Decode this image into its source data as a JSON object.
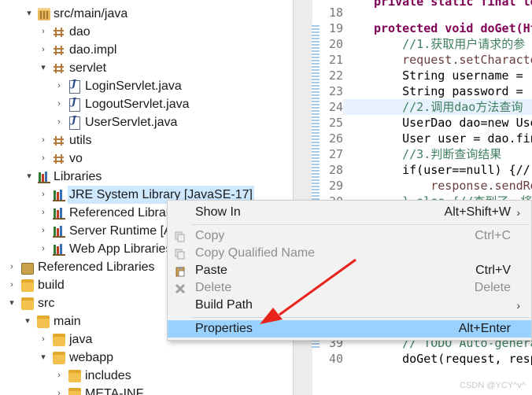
{
  "explorer": {
    "rows": [
      {
        "label": "src/main/java",
        "arrow": "▾",
        "icon": "source-folder-icon"
      },
      {
        "label": "dao",
        "arrow": "›",
        "icon": "package-icon"
      },
      {
        "label": "dao.impl",
        "arrow": "›",
        "icon": "package-icon"
      },
      {
        "label": "servlet",
        "arrow": "▾",
        "icon": "package-icon"
      },
      {
        "label": "LoginServlet.java",
        "arrow": "›",
        "icon": "java-file-icon"
      },
      {
        "label": "LogoutServlet.java",
        "arrow": "›",
        "icon": "java-file-icon"
      },
      {
        "label": "UserServlet.java",
        "arrow": "›",
        "icon": "java-file-icon"
      },
      {
        "label": "utils",
        "arrow": "›",
        "icon": "package-icon"
      },
      {
        "label": "vo",
        "arrow": "›",
        "icon": "package-icon"
      },
      {
        "label": "Libraries",
        "arrow": "▾",
        "icon": "library-icon"
      },
      {
        "label": "JRE System Library [JavaSE-17]",
        "arrow": "›",
        "icon": "library-icon"
      },
      {
        "label": "Referenced Libraries",
        "arrow": "›",
        "icon": "library-icon"
      },
      {
        "label": "Server Runtime [Apache Tomcat]",
        "arrow": "›",
        "icon": "library-icon"
      },
      {
        "label": "Web App Libraries",
        "arrow": "›",
        "icon": "library-icon"
      },
      {
        "label": "Referenced Libraries",
        "arrow": "›",
        "icon": "library-icon"
      },
      {
        "label": "build",
        "arrow": "›",
        "icon": "folder-icon"
      },
      {
        "label": "src",
        "arrow": "▾",
        "icon": "folder-icon"
      },
      {
        "label": "main",
        "arrow": "▾",
        "icon": "folder-icon"
      },
      {
        "label": "java",
        "arrow": "›",
        "icon": "folder-icon"
      },
      {
        "label": "webapp",
        "arrow": "▾",
        "icon": "folder-icon"
      },
      {
        "label": "includes",
        "arrow": "›",
        "icon": "folder-icon"
      },
      {
        "label": "META-INF",
        "arrow": "›",
        "icon": "folder-icon"
      }
    ]
  },
  "editor": {
    "lines": [
      {
        "num": "",
        "text": "private static final lo"
      },
      {
        "num": "18",
        "text": ""
      },
      {
        "num": "19",
        "text": "protected void doGet(Ht"
      },
      {
        "num": "20",
        "text": "    //1.获取用户请求的参"
      },
      {
        "num": "21",
        "text": "    request.setCharacte"
      },
      {
        "num": "22",
        "text": "    String username = r"
      },
      {
        "num": "23",
        "text": "    String password = r"
      },
      {
        "num": "24",
        "text": "    //2.调用dao方法查询"
      },
      {
        "num": "25",
        "text": "    UserDao dao=new Use"
      },
      {
        "num": "26",
        "text": "    User user = dao.fin"
      },
      {
        "num": "27",
        "text": "    //3.判断查询结果"
      },
      {
        "num": "28",
        "text": "    if(user==null) {//"
      },
      {
        "num": "29",
        "text": "        response.sendRe"
      },
      {
        "num": "30",
        "text": "    } else {//查到了，将"
      },
      {
        "num": "39",
        "text": "    // TODO Auto-genera"
      },
      {
        "num": "40",
        "text": "    doGet(request, resp"
      }
    ]
  },
  "context_menu": {
    "items": [
      {
        "label": "Show In",
        "shortcut": "Alt+Shift+W",
        "submenu": "›",
        "enabled": true,
        "icon": ""
      },
      {
        "label": "Copy",
        "shortcut": "Ctrl+C",
        "submenu": "",
        "enabled": false,
        "icon": "copy-icon"
      },
      {
        "label": "Copy Qualified Name",
        "shortcut": "",
        "submenu": "",
        "enabled": false,
        "icon": "copy-qualified-name-icon"
      },
      {
        "label": "Paste",
        "shortcut": "Ctrl+V",
        "submenu": "",
        "enabled": true,
        "icon": "paste-icon"
      },
      {
        "label": "Delete",
        "shortcut": "Delete",
        "submenu": "",
        "enabled": false,
        "icon": "delete-icon"
      },
      {
        "label": "Build Path",
        "shortcut": "",
        "submenu": "›",
        "enabled": true,
        "icon": ""
      },
      {
        "label": "Properties",
        "shortcut": "Alt+Enter",
        "submenu": "",
        "enabled": true,
        "icon": "",
        "highlighted": true
      }
    ]
  },
  "annotation": {
    "color": "#e8231b"
  },
  "watermark": {
    "text": "CSDN @YCY^v^"
  },
  "colors": {
    "keyword": "#7f0055",
    "comment": "#3f7f5f",
    "menu_highlight": "#99d1ff",
    "selection": "#cde8ff"
  }
}
